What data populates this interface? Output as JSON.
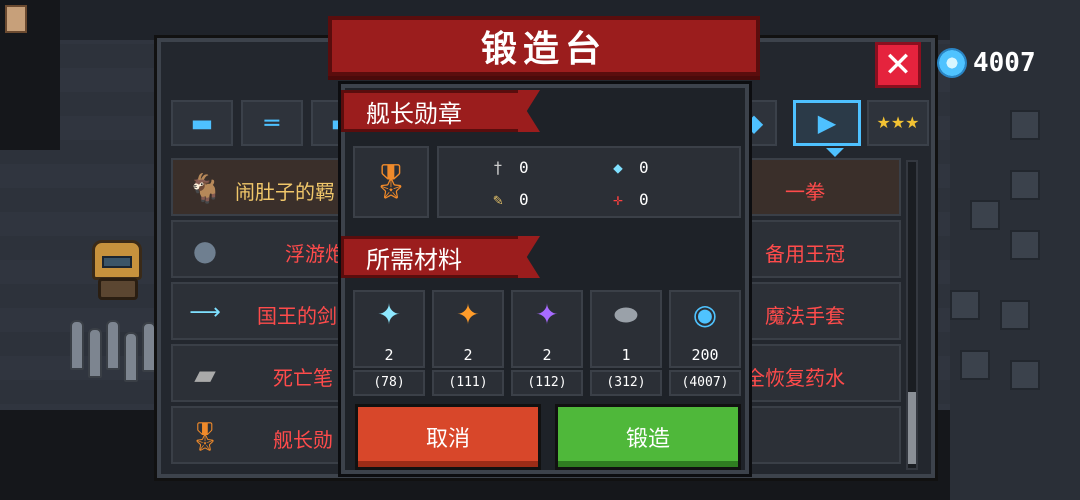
{
  "header": {
    "title": "锻造台",
    "close_glyph": "✕",
    "gems": "4007"
  },
  "tabs": [
    {
      "icon": "pistol-icon",
      "glyph": "▬"
    },
    {
      "icon": "rifle-icon",
      "glyph": "═"
    },
    {
      "icon": "blaster-icon",
      "glyph": "▬"
    },
    {
      "icon": "fin-icon",
      "glyph": "◆"
    },
    {
      "icon": "fish-icon",
      "glyph": "▶",
      "active": true
    },
    {
      "icon": "stars-icon",
      "glyph": "★★★"
    }
  ],
  "item_list": [
    {
      "icon": "goat-icon",
      "glyph": "🐐",
      "left_name": "闹肚子的羁",
      "right_name": "一拳",
      "gold": true
    },
    {
      "icon": "bomb-icon",
      "glyph": "●",
      "left_name": "浮游炮",
      "right_name": "备用王冠"
    },
    {
      "icon": "sword-icon",
      "glyph": "⟶",
      "left_name": "国王的剑",
      "right_name": "魔法手套"
    },
    {
      "icon": "notebook-icon",
      "glyph": "▰",
      "left_name": "死亡笔",
      "right_name": "全恢复药水"
    },
    {
      "icon": "medal-icon",
      "glyph": "🎖",
      "left_name": "舰长勋",
      "right_name": ""
    }
  ],
  "dialog": {
    "item_title": "舰长勋章",
    "item_glyph": "🎖",
    "stats": {
      "attack": "0",
      "crit": "0",
      "energy": "0",
      "accuracy": "0"
    },
    "materials_title": "所需材料",
    "materials": [
      {
        "icon": "cyan-crystal-icon",
        "glyph": "✦",
        "color": "#8ee8ff",
        "need": "2",
        "own": "(78)"
      },
      {
        "icon": "orange-crystal-icon",
        "glyph": "✦",
        "color": "#ff9c2a",
        "need": "2",
        "own": "(111)"
      },
      {
        "icon": "purple-crystal-icon",
        "glyph": "✦",
        "color": "#a76bff",
        "need": "2",
        "own": "(112)"
      },
      {
        "icon": "ore-icon",
        "glyph": "⬬",
        "color": "#9aa1a9",
        "need": "1",
        "own": "(312)"
      },
      {
        "icon": "gem-coin-icon",
        "glyph": "◉",
        "color": "#4fc3ff",
        "need": "200",
        "own": "(4007)"
      }
    ],
    "cancel_label": "取消",
    "forge_label": "锻造"
  },
  "colors": {
    "banner": "#9b1d1d",
    "cancel": "#d8472a",
    "forge": "#4fb83a",
    "gem": "#4fc3ff",
    "item_name": "#ff4b4b"
  }
}
